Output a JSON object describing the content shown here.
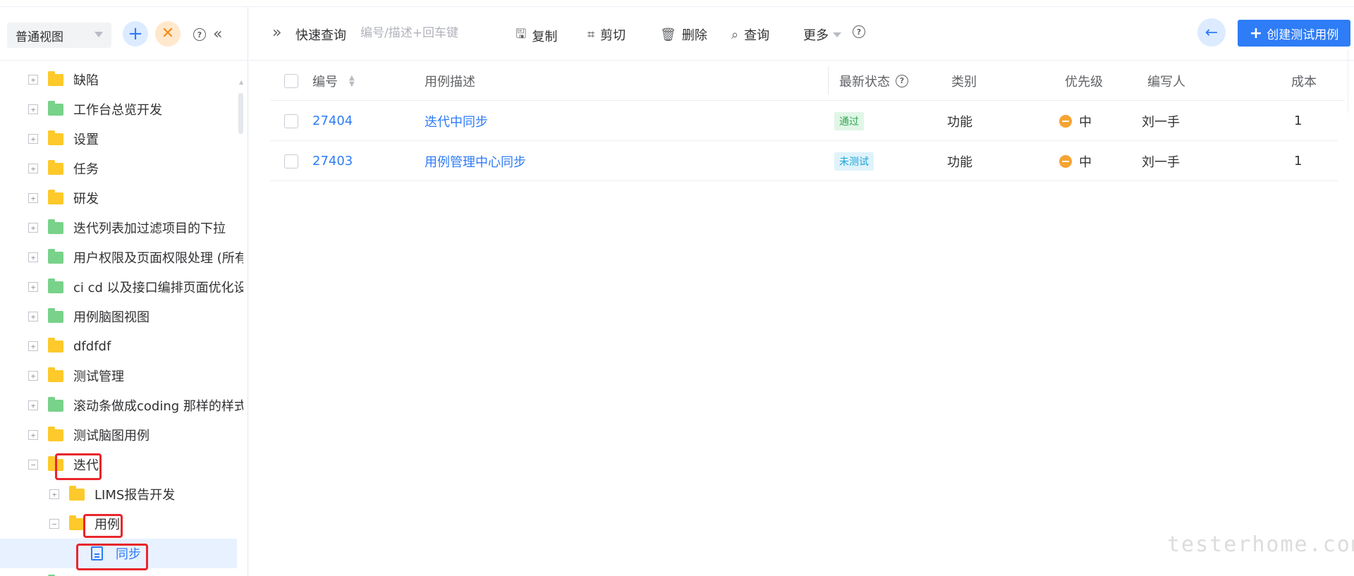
{
  "sidebar": {
    "view_select": "普通视图",
    "tree": [
      {
        "label": "缺陷",
        "color": "yellow",
        "expander": "+"
      },
      {
        "label": "工作台总览开发",
        "color": "green",
        "expander": "+"
      },
      {
        "label": "设置",
        "color": "yellow",
        "expander": "+"
      },
      {
        "label": "任务",
        "color": "yellow",
        "expander": "+"
      },
      {
        "label": "研发",
        "color": "yellow",
        "expander": "+"
      },
      {
        "label": "迭代列表加过滤项目的下拉",
        "color": "green",
        "expander": "+"
      },
      {
        "label": "用户权限及页面权限处理 (所有",
        "color": "green",
        "expander": "+"
      },
      {
        "label": "ci cd 以及接口编排页面优化设",
        "color": "green",
        "expander": "+"
      },
      {
        "label": " 用例脑图视图",
        "color": "green",
        "expander": "+"
      },
      {
        "label": "dfdfdf",
        "color": "yellow",
        "expander": "+"
      },
      {
        "label": "测试管理",
        "color": "yellow",
        "expander": "+"
      },
      {
        "label": "滚动条做成coding 那样的样式",
        "color": "green",
        "expander": "+"
      },
      {
        "label": "测试脑图用例",
        "color": "yellow",
        "expander": "+"
      },
      {
        "label": "迭代",
        "color": "yellow",
        "expander": "−"
      },
      {
        "label": "LIMS报告开发",
        "color": "yellow",
        "expander": "+"
      },
      {
        "label": "用例",
        "color": "yellow",
        "expander": "−"
      },
      {
        "label": "同步",
        "color": "doc",
        "expander": ""
      }
    ]
  },
  "toolbar": {
    "quick_label": "快速查询",
    "search_placeholder": "编号/描述+回车键",
    "copy": "复制",
    "cut": "剪切",
    "delete": "删除",
    "query": "查询",
    "more": "更多",
    "create": "创建测试用例"
  },
  "table": {
    "headers": {
      "id": "编号",
      "desc": "用例描述",
      "status": "最新状态",
      "category": "类别",
      "priority": "优先级",
      "author": "编写人",
      "cost": "成本"
    },
    "rows": [
      {
        "id": "27404",
        "desc": "迭代中同步",
        "status": "通过",
        "category": "功能",
        "priority": "中",
        "author": "刘一手",
        "cost": "1"
      },
      {
        "id": "27403",
        "desc": "用例管理中心同步",
        "status": "未测试",
        "category": "功能",
        "priority": "中",
        "author": "刘一手",
        "cost": "1"
      }
    ]
  },
  "watermark": "testerhome.com",
  "colors": {
    "accent": "#2e7cf6",
    "folder_yellow": "#fdc92b",
    "folder_green": "#78d28a",
    "priority_medium": "#f5a431",
    "highlight_red": "#e8262b"
  }
}
